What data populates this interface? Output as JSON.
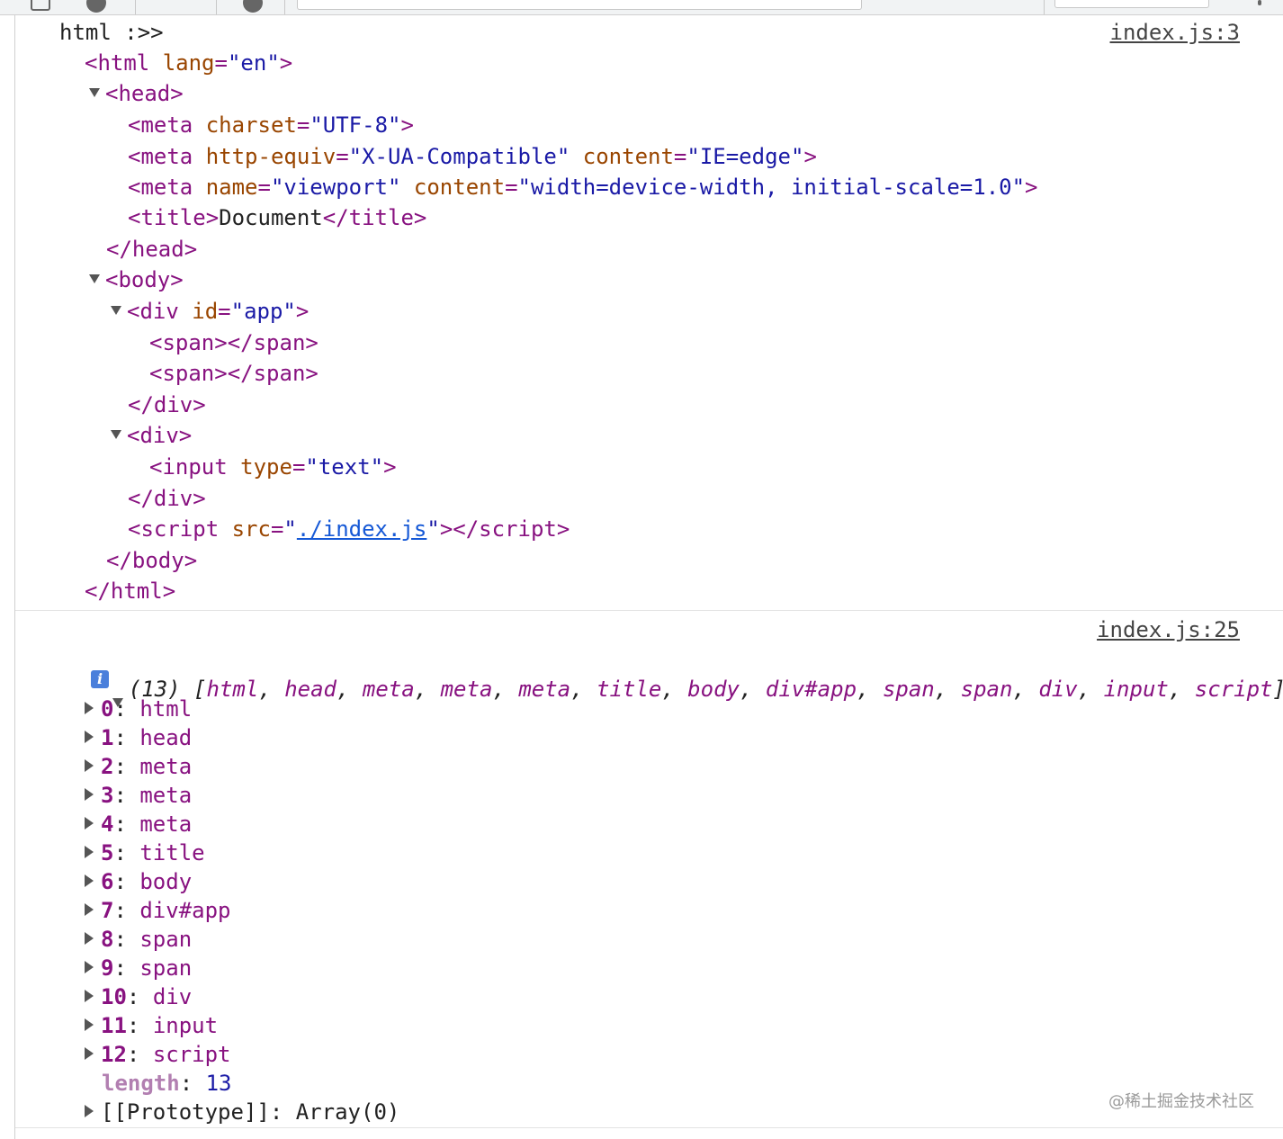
{
  "console": {
    "message1": {
      "source": "index.js:3",
      "label": "html :>>",
      "html_lang_attr": "lang",
      "html_lang_val": "en",
      "meta1_attr": "charset",
      "meta1_val": "UTF-8",
      "meta2_attr1": "http-equiv",
      "meta2_val1": "X-UA-Compatible",
      "meta2_attr2": "content",
      "meta2_val2": "IE=edge",
      "meta3_attr1": "name",
      "meta3_val1": "viewport",
      "meta3_attr2": "content",
      "meta3_val2": "width=device-width, initial-scale=1.0",
      "title_text": "Document",
      "div1_attr": "id",
      "div1_val": "app",
      "input_attr": "type",
      "input_val": "text",
      "script_attr": "src",
      "script_val": "./index.js"
    },
    "message2": {
      "source": "index.js:25",
      "count": "(13)",
      "summary_items": [
        "html",
        "head",
        "meta",
        "meta",
        "meta",
        "title",
        "body",
        "div#app",
        "span",
        "span",
        "div",
        "input",
        "script"
      ],
      "info_icon": "i",
      "entries": [
        {
          "key": "0",
          "value": "html"
        },
        {
          "key": "1",
          "value": "head"
        },
        {
          "key": "2",
          "value": "meta"
        },
        {
          "key": "3",
          "value": "meta"
        },
        {
          "key": "4",
          "value": "meta"
        },
        {
          "key": "5",
          "value": "title"
        },
        {
          "key": "6",
          "value": "body"
        },
        {
          "key": "7",
          "value": "div#app"
        },
        {
          "key": "8",
          "value": "span"
        },
        {
          "key": "9",
          "value": "span"
        },
        {
          "key": "10",
          "value": "div"
        },
        {
          "key": "11",
          "value": "input"
        },
        {
          "key": "12",
          "value": "script"
        }
      ],
      "length_key": "length",
      "length_value": "13",
      "prototype_key": "[[Prototype]]",
      "prototype_value": "Array(0)"
    }
  },
  "watermark": "@稀土掘金技术社区"
}
